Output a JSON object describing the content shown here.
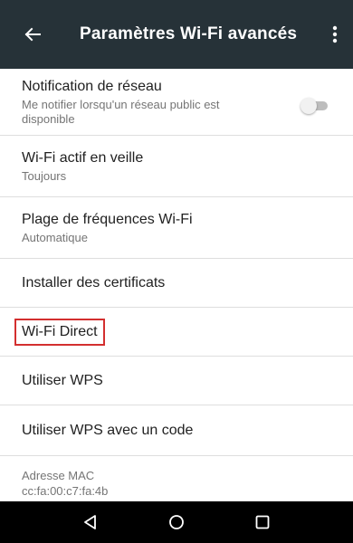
{
  "header": {
    "title": "Paramètres Wi-Fi avancés",
    "back_icon": "back-arrow-icon",
    "more_icon": "more-vert-icon",
    "background": "#263238"
  },
  "settings": {
    "network_notification": {
      "title": "Notification de réseau",
      "summary": "Me notifier lorsqu'un réseau public est disponible",
      "toggle_on": false
    },
    "wifi_sleep": {
      "title": "Wi-Fi actif en veille",
      "summary": "Toujours"
    },
    "frequency_band": {
      "title": "Plage de fréquences Wi-Fi",
      "summary": "Automatique"
    },
    "install_certs": {
      "title": "Installer des certificats"
    },
    "wifi_direct": {
      "title": "Wi-Fi Direct",
      "highlight_color": "#d32f2f"
    },
    "wps": {
      "title": "Utiliser WPS"
    },
    "wps_pin": {
      "title": "Utiliser WPS avec un code"
    },
    "mac_address": {
      "label": "Adresse MAC",
      "value": "cc:fa:00:c7:fa:4b"
    }
  },
  "navbar": {
    "back_icon": "nav-back-icon",
    "home_icon": "nav-home-icon",
    "recents_icon": "nav-recents-icon"
  }
}
